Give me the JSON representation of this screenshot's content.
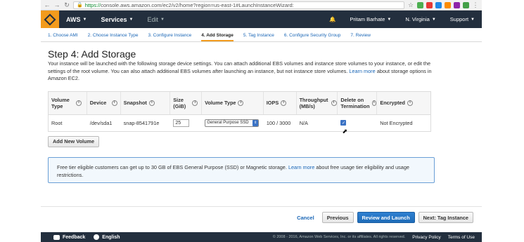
{
  "browser": {
    "url_prefix": "https://",
    "url_rest": "console.aws.amazon.com/ec2/v2/home?region=us-east-1#LaunchInstanceWizard:"
  },
  "topnav": {
    "aws": "AWS",
    "services": "Services",
    "edit": "Edit",
    "user": "Pritam Barhate",
    "region": "N. Virginia",
    "support": "Support"
  },
  "steps": [
    "1. Choose AMI",
    "2. Choose Instance Type",
    "3. Configure Instance",
    "4. Add Storage",
    "5. Tag Instance",
    "6. Configure Security Group",
    "7. Review"
  ],
  "page": {
    "title": "Step 4: Add Storage",
    "desc_text": "Your instance will be launched with the following storage device settings. You can attach additional EBS volumes and instance store volumes to your instance, or edit the settings of the root volume. You can also attach additional EBS volumes after launching an instance, but not instance store volumes.",
    "desc_link": "Learn more",
    "desc_tail": "about storage options in Amazon EC2."
  },
  "table": {
    "headers": {
      "volume_type": "Volume Type",
      "device": "Device",
      "snapshot": "Snapshot",
      "size": "Size (GiB)",
      "vtype": "Volume Type",
      "iops": "IOPS",
      "throughput": "Throughput (MB/s)",
      "delete": "Delete on Termination",
      "encrypted": "Encrypted"
    },
    "row": {
      "volume_type": "Root",
      "device": "/dev/sda1",
      "snapshot": "snap-8541791e",
      "size": "25",
      "vtype": "General Purpose SSD",
      "iops": "100 / 3000",
      "throughput": "N/A",
      "delete_checked": true,
      "encrypted": "Not Encrypted"
    }
  },
  "add_volume": "Add New Volume",
  "notice": {
    "text": "Free tier eligible customers can get up to 30 GB of EBS General Purpose (SSD) or Magnetic storage.",
    "link": "Learn more",
    "tail": "about free usage tier eligibility and usage restrictions."
  },
  "actions": {
    "cancel": "Cancel",
    "previous": "Previous",
    "review": "Review and Launch",
    "next": "Next: Tag Instance"
  },
  "footer": {
    "feedback": "Feedback",
    "english": "English",
    "copyright": "© 2008 - 2016, Amazon Web Services, Inc. or its affiliates. All rights reserved.",
    "privacy": "Privacy Policy",
    "terms": "Terms of Use"
  },
  "colors": {
    "aws_orange": "#f29b1d",
    "nav_dark": "#232f3e",
    "link_blue": "#1a66b6",
    "primary_blue": "#1f6cb8"
  }
}
